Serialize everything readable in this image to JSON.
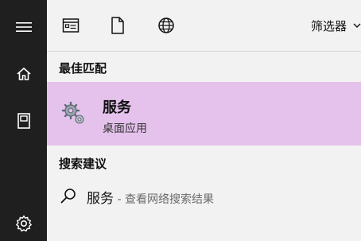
{
  "sidebar": {
    "icons": [
      "hamburger-menu-icon",
      "home-icon",
      "notebook-icon",
      "settings-gear-icon"
    ]
  },
  "toolbar": {
    "icons": [
      "apps-window-icon",
      "document-icon",
      "web-globe-icon"
    ],
    "filter_label": "筛选器"
  },
  "sections": {
    "best_match_title": "最佳匹配",
    "search_suggestions_title": "搜索建议"
  },
  "best_match": {
    "name": "服务",
    "subtitle": "桌面应用",
    "icon": "services-gears-icon"
  },
  "suggestion": {
    "query": "服务",
    "dash": " - ",
    "hint": "查看网络搜索结果",
    "icon": "search-icon"
  },
  "colors": {
    "left_bar": "#1f1f1f",
    "panel_bg": "#f2f2f2",
    "highlight": "#e5c2ec"
  }
}
